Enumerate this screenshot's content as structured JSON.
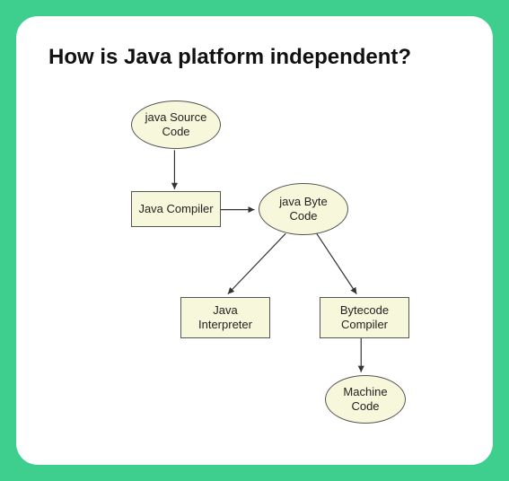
{
  "title": "How is Java platform independent?",
  "nodes": {
    "source": "java Source Code",
    "compiler": "Java Compiler",
    "bytecode": "java Byte Code",
    "interpreter": "Java Interpreter",
    "bcCompiler": "Bytecode Compiler",
    "machine": "Machine Code"
  }
}
